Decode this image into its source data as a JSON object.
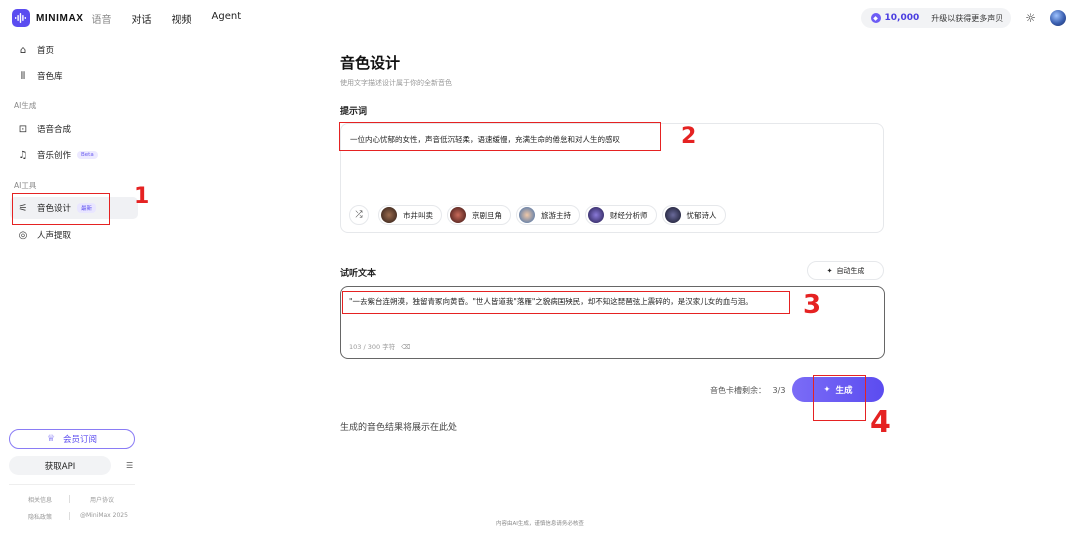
{
  "header": {
    "logo_text": "MINIMAX",
    "logo_sub": "语音",
    "nav": [
      "对话",
      "视频",
      "Agent"
    ],
    "credits": "10,000",
    "upgrade": "升级以获得更多声贝"
  },
  "sidebar": {
    "home": "首页",
    "library": "音色库",
    "section_ai_gen": "AI生成",
    "tts": "语音合成",
    "music": "音乐创作",
    "music_badge": "Beta",
    "section_ai_tools": "AI工具",
    "voice_design": "音色设计",
    "voice_design_badge": "最新",
    "vocal_extract": "人声提取",
    "member_btn": "会员订阅",
    "api_btn": "获取API",
    "footer": [
      "相关信息",
      "用户协议",
      "隐私政策",
      "@MiniMax 2025"
    ]
  },
  "main": {
    "title": "音色设计",
    "subtitle": "使用文字描述设计属于你的全新音色",
    "prompt_label": "提示词",
    "prompt_text": "一位内心忧郁的女性，声音低沉轻柔，语速缓慢，充满生命的倦怠和对人生的感叹",
    "chips": [
      "市井叫卖",
      "京剧旦角",
      "旅游主持",
      "财经分析师",
      "忧郁诗人"
    ],
    "listen_label": "试听文本",
    "auto_gen": "自动生成",
    "listen_text": "\"一去紫台连朔漠，独留青冢向黄昏。\"世人皆道我\"落雁\"之貌病国殃民，却不知这琵琶弦上震碎的，是汉家儿女的血与泪。",
    "char_count": "103 / 300 字符",
    "remain_label": "音色卡槽剩余：",
    "remain_value": "3/3",
    "generate": "生成",
    "result_hint": "生成的音色结果将展示在此处",
    "bottom_note": "内容由AI生成，谨慎信息请务必核查"
  },
  "annotations": [
    "1",
    "2",
    "3",
    "4"
  ],
  "colors": {
    "accent": "#5b4cf0",
    "annotation": "#e52222"
  }
}
